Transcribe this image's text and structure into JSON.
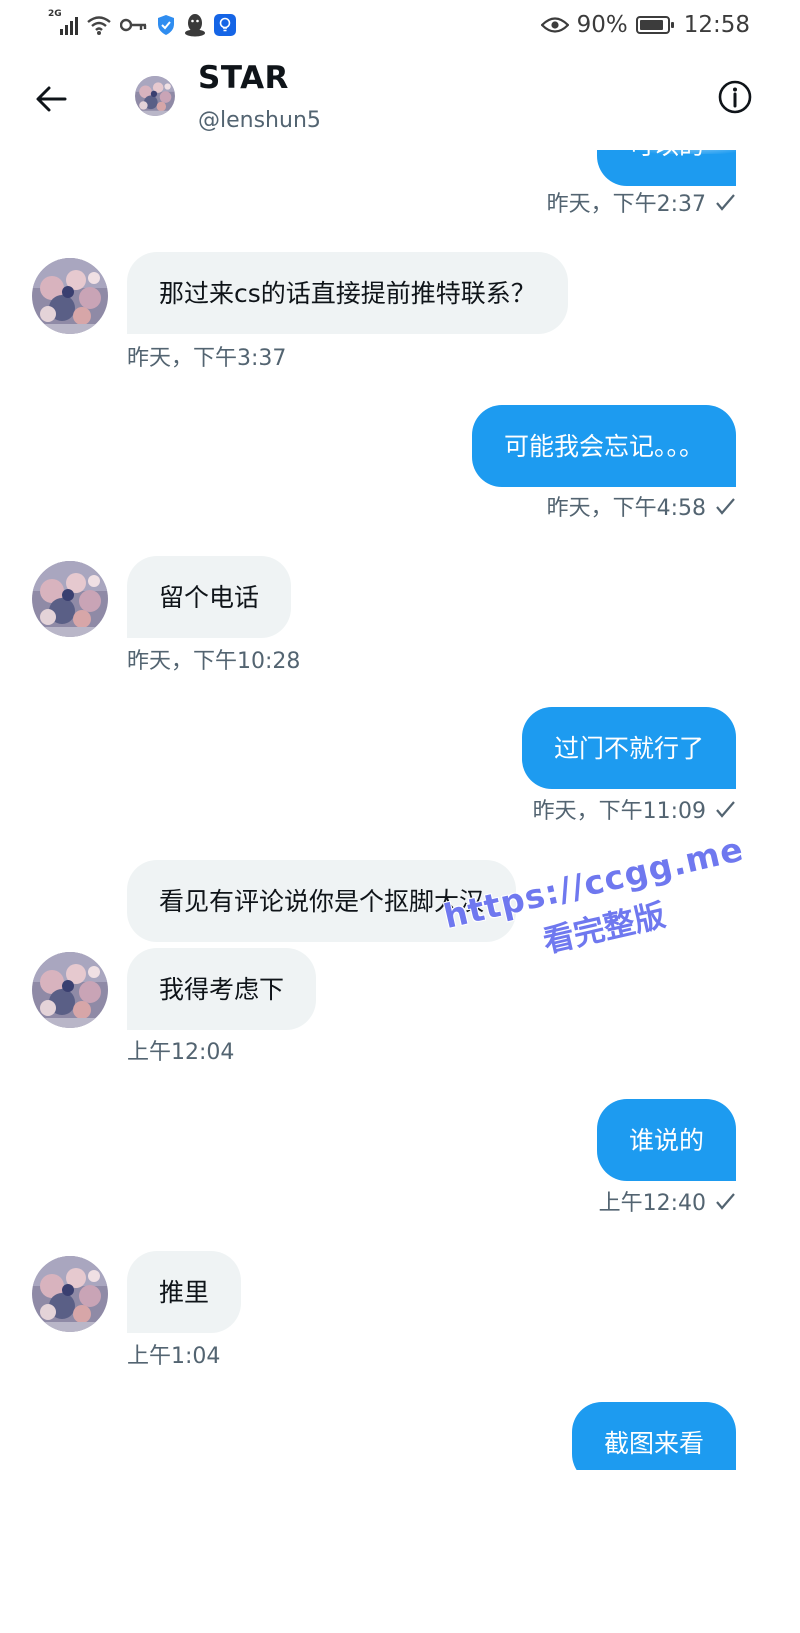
{
  "status_bar": {
    "network": "2G",
    "battery": "90%",
    "battery_level": 0.9,
    "time": "12:58"
  },
  "header": {
    "name": "STAR",
    "handle": "@lenshun5"
  },
  "messages": [
    {
      "direction": "out",
      "text": "可以的",
      "time": "昨天，下午2:37",
      "partial": true
    },
    {
      "direction": "in",
      "text": "那过来cs的话直接提前推特联系？",
      "time": "昨天，下午3:37"
    },
    {
      "direction": "out",
      "text": "可能我会忘记。。。",
      "time": "昨天，下午4:58"
    },
    {
      "direction": "in",
      "text": "留个电话",
      "time": "昨天，下午10:28"
    },
    {
      "direction": "out",
      "text": "过门不就行了",
      "time": "昨天，下午11:09"
    },
    {
      "direction": "in",
      "text": "看见有评论说你是个抠脚大汉"
    },
    {
      "direction": "in",
      "text": "我得考虑下",
      "time": "上午12:04"
    },
    {
      "direction": "out",
      "text": "谁说的",
      "time": "上午12:40"
    },
    {
      "direction": "in",
      "text": "推里",
      "time": "上午1:04"
    },
    {
      "direction": "out",
      "text": "截图来看",
      "partial": true
    }
  ],
  "watermark": {
    "line1": "https://ccgg.me",
    "line2": "看完整版"
  },
  "colors": {
    "outgoing_bubble": "#1d9bf0",
    "incoming_bubble": "#eff3f4",
    "timestamp": "#536471",
    "watermark": "#6f78ef"
  },
  "icons": [
    "back-arrow-icon",
    "info-icon",
    "read-check-icon",
    "eye-icon",
    "key-icon",
    "shield-icon",
    "penguin-icon",
    "lightbulb-icon",
    "wifi-icon",
    "signal-icon",
    "battery-icon"
  ]
}
